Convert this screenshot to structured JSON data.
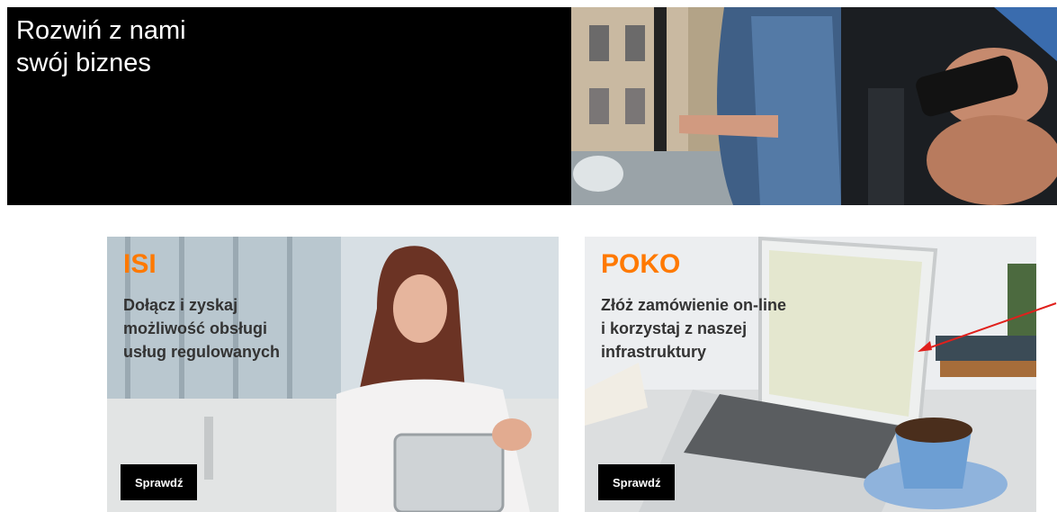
{
  "hero": {
    "title_line1": "Rozwiń z nami",
    "title_line2": "swój biznes"
  },
  "cards": [
    {
      "brand": "ISI",
      "text_lines": [
        "Dołącz i zyskaj",
        "możliwość obsługi",
        "usług regulowanych"
      ],
      "button_label": "Sprawdź"
    },
    {
      "brand": "POKO",
      "text_lines": [
        "Złóż zamówienie on-line",
        "i korzystaj z naszej",
        "infrastruktury"
      ],
      "button_label": "Sprawdź"
    }
  ],
  "colors": {
    "brand_orange": "#ff7900",
    "annotation_arrow": "#e0201c"
  }
}
